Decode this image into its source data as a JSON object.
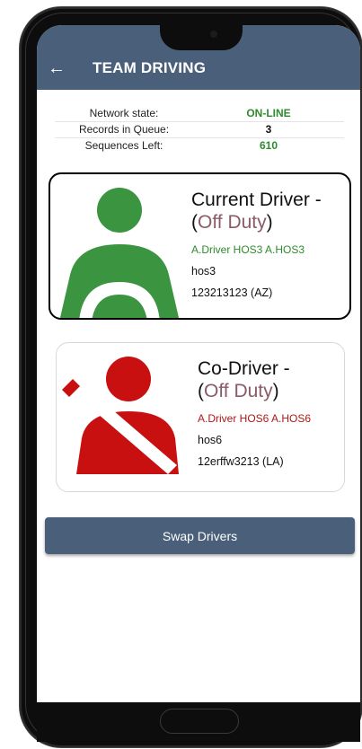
{
  "appbar": {
    "title": "TEAM DRIVING",
    "back_icon": "arrow-left-icon"
  },
  "status": {
    "rows": [
      {
        "label": "Network state:",
        "value": "ON-LINE",
        "color": "#2e8b2e"
      },
      {
        "label": "Records in Queue:",
        "value": "3",
        "color": "#111111"
      },
      {
        "label": "Sequences Left:",
        "value": "610",
        "color": "#2e8b2e"
      }
    ]
  },
  "current_driver": {
    "role": "Current Driver -",
    "duty_open": "(",
    "duty_status": "Off Duty",
    "duty_close": ")",
    "name": "A.Driver HOS3 A.HOS3",
    "id": "hos3",
    "license": "123213123 (AZ)",
    "icon": "driver-steering-wheel-icon",
    "color": "#3a9440"
  },
  "co_driver": {
    "role": "Co-Driver -",
    "duty_open": "(",
    "duty_status": "Off Duty",
    "duty_close": ")",
    "name": "A.Driver HOS6 A.HOS6",
    "id": "hos6",
    "license": "12erffw3213 (LA)",
    "icon": "passenger-seatbelt-icon",
    "color": "#c81010"
  },
  "swap_button": {
    "label": "Swap Drivers"
  },
  "colors": {
    "appbar": "#4a5f7a",
    "duty_status": "#8b5a66"
  }
}
